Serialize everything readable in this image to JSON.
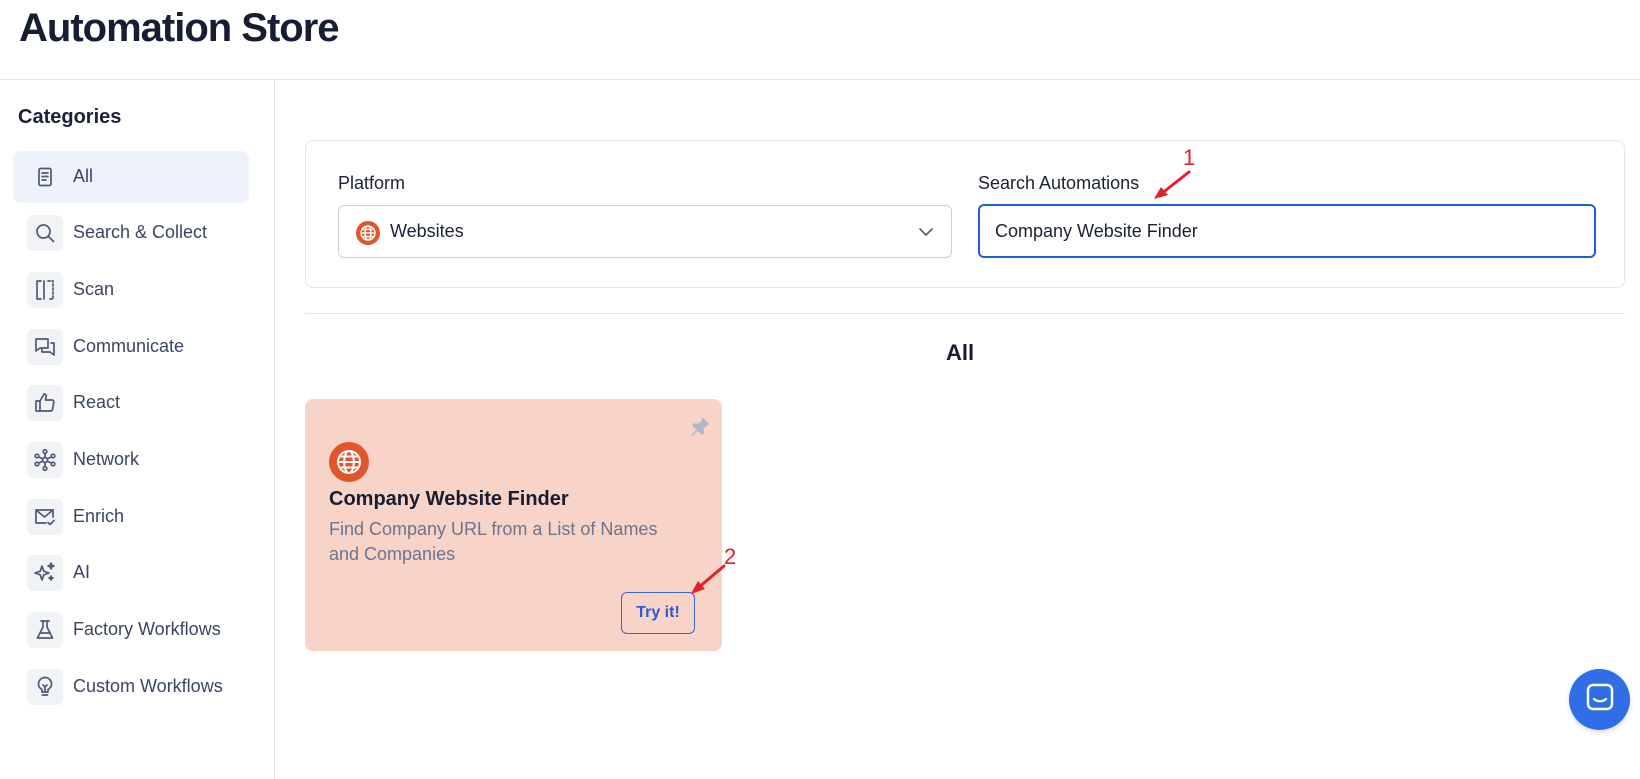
{
  "header": {
    "title": "Automation Store"
  },
  "sidebar": {
    "heading": "Categories",
    "items": [
      {
        "label": "All",
        "icon": "document-icon",
        "active": true
      },
      {
        "label": "Search & Collect",
        "icon": "search-icon"
      },
      {
        "label": "Scan",
        "icon": "scan-icon"
      },
      {
        "label": "Communicate",
        "icon": "chat-bubbles-icon"
      },
      {
        "label": "React",
        "icon": "thumbs-up-icon"
      },
      {
        "label": "Network",
        "icon": "network-icon"
      },
      {
        "label": "Enrich",
        "icon": "mail-check-icon"
      },
      {
        "label": "AI",
        "icon": "sparkles-icon"
      },
      {
        "label": "Factory Workflows",
        "icon": "flask-icon"
      },
      {
        "label": "Custom Workflows",
        "icon": "lightbulb-icon"
      }
    ]
  },
  "filters": {
    "platform_label": "Platform",
    "platform_value": "Websites",
    "search_label": "Search Automations",
    "search_value": "Company Website Finder"
  },
  "section": {
    "title": "All"
  },
  "cards": [
    {
      "title": "Company Website Finder",
      "description": "Find Company URL from a List of Names and Companies",
      "button": "Try it!"
    }
  ],
  "annotations": {
    "first": "1",
    "second": "2"
  },
  "colors": {
    "accent": "#1f5fdc",
    "card_bg": "#f8d3c7",
    "globe": "#e4542c",
    "annotation": "#e0202a"
  }
}
